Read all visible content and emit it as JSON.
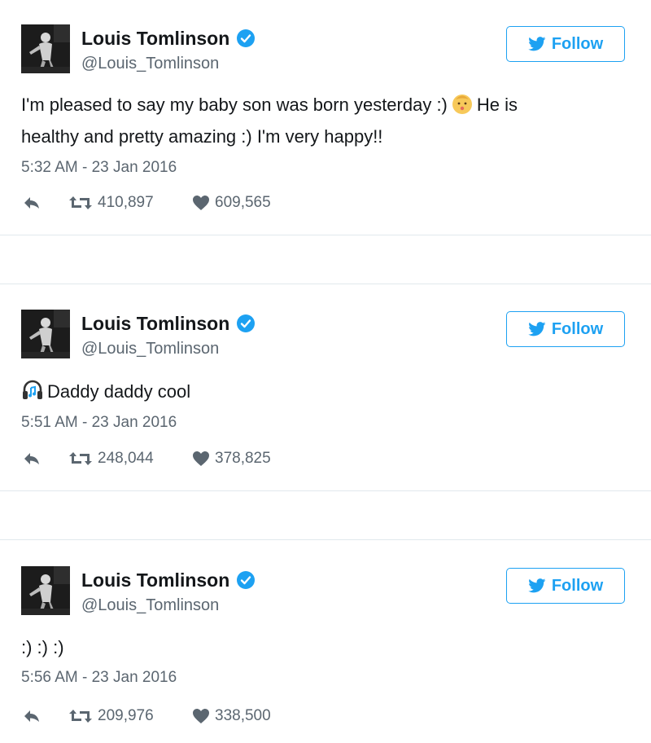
{
  "tweets": [
    {
      "author_name": "Louis Tomlinson",
      "handle": "@Louis_Tomlinson",
      "follow_label": "Follow",
      "text_line1_a": "I'm pleased to say my baby son was born yesterday :)",
      "text_line1_b": "He is",
      "text_line2": "healthy and pretty amazing :) I'm very happy!!",
      "emoji": "baby-icon",
      "timestamp": "5:32 AM - 23 Jan 2016",
      "retweets": "410,897",
      "likes": "609,565"
    },
    {
      "author_name": "Louis Tomlinson",
      "handle": "@Louis_Tomlinson",
      "follow_label": "Follow",
      "text": "Daddy daddy cool",
      "emoji": "headphone-music-icon",
      "timestamp": "5:51 AM - 23 Jan 2016",
      "retweets": "248,044",
      "likes": "378,825"
    },
    {
      "author_name": "Louis Tomlinson",
      "handle": "@Louis_Tomlinson",
      "follow_label": "Follow",
      "text": ":) :) :)",
      "timestamp": "5:56 AM - 23 Jan 2016",
      "retweets": "209,976",
      "likes": "338,500"
    }
  ],
  "colors": {
    "accent": "#1da1f2",
    "secondary_text": "#5b6670",
    "divider": "#e1e8ed"
  }
}
